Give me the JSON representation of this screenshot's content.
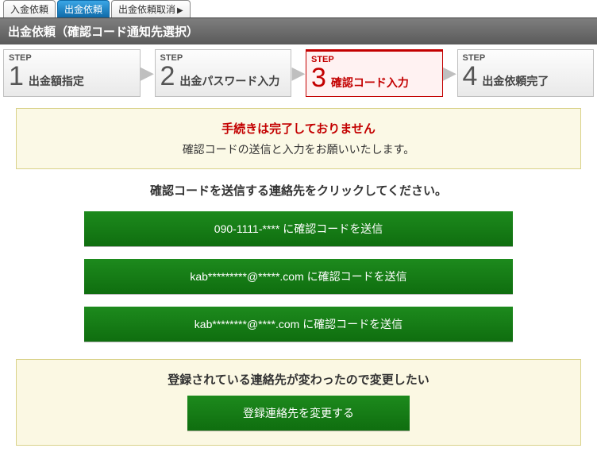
{
  "tabs": {
    "deposit": "入金依頼",
    "withdraw": "出金依頼",
    "cancel": "出金依頼取消"
  },
  "title": "出金依頼（確認コード通知先選択）",
  "step_label": "STEP",
  "steps": {
    "s1": {
      "num": "1",
      "text": "出金額指定"
    },
    "s2": {
      "num": "2",
      "text": "出金パスワード入力"
    },
    "s3": {
      "num": "3",
      "text": "確認コード入力"
    },
    "s4": {
      "num": "4",
      "text": "出金依頼完了"
    }
  },
  "notice": {
    "head": "手続きは完了しておりません",
    "sub": "確認コードの送信と入力をお願いいたします。"
  },
  "instruction": "確認コードを送信する連絡先をクリックしてください。",
  "contacts": {
    "phone": "090-1111-**** に確認コードを送信",
    "email1": "kab*********@*****.com に確認コードを送信",
    "email2": "kab********@****.com に確認コードを送信"
  },
  "change": {
    "head": "登録されている連絡先が変わったので変更したい",
    "button": "登録連絡先を変更する"
  }
}
